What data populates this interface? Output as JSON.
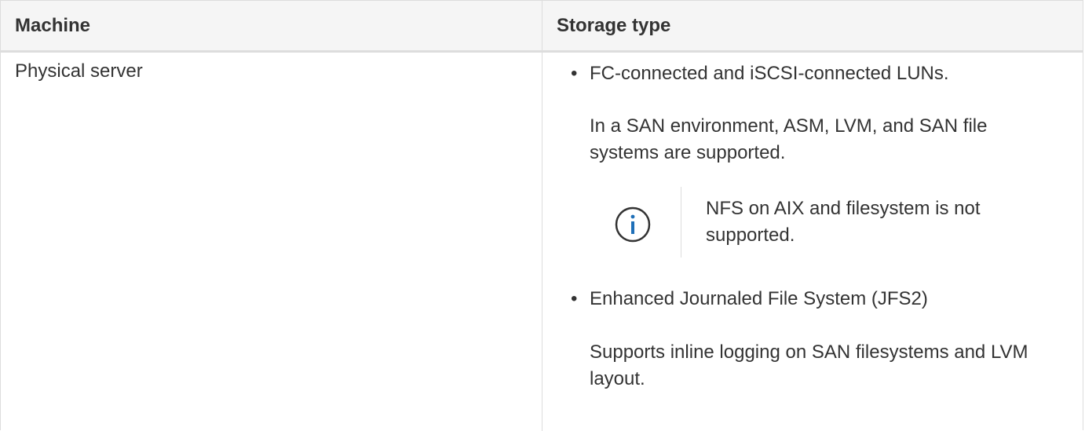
{
  "table": {
    "headers": {
      "machine": "Machine",
      "storage_type": "Storage type"
    },
    "rows": [
      {
        "machine": "Physical server",
        "storage": {
          "items": [
            {
              "bullet": "•",
              "title": "FC-connected and iSCSI-connected LUNs.",
              "description": "In a SAN environment, ASM, LVM, and SAN file systems are supported.",
              "note": {
                "icon": "info-icon",
                "text": "NFS on AIX and filesystem is not supported."
              }
            },
            {
              "bullet": "•",
              "title": "Enhanced Journaled File System (JFS2)",
              "description": "Supports inline logging on SAN filesystems and LVM layout."
            }
          ]
        }
      }
    ]
  },
  "colors": {
    "header_bg": "#f5f5f5",
    "border": "#dddddd",
    "text": "#333333",
    "info_icon": "#1e6fb8"
  }
}
